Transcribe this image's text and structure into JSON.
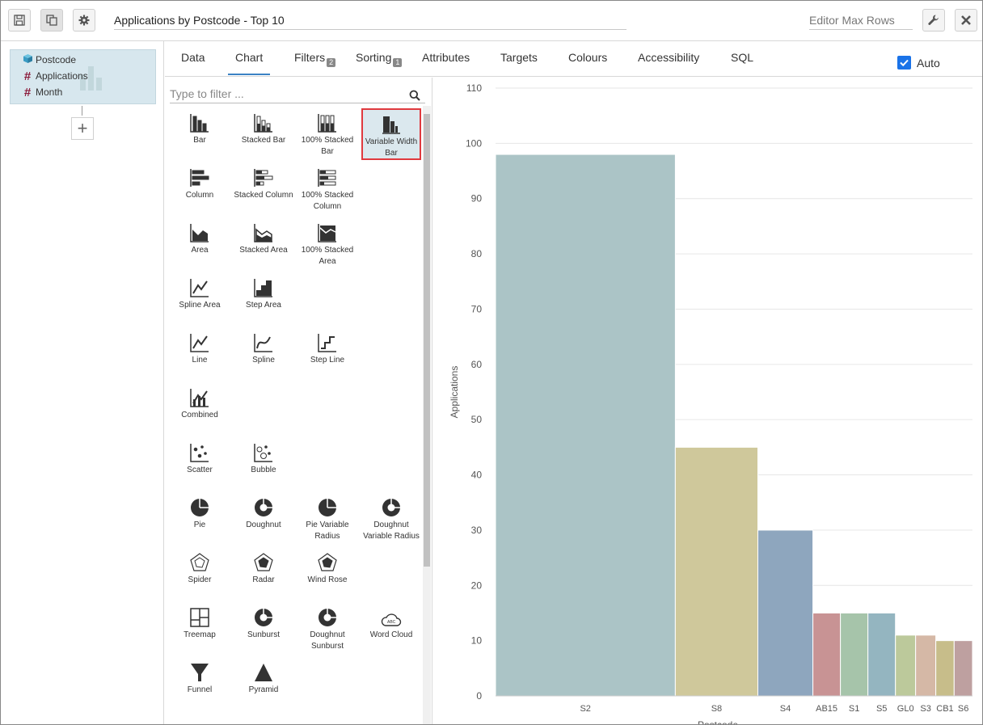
{
  "toolbar": {
    "title": "Applications by Postcode - Top 10",
    "max_rows_placeholder": "Editor Max Rows"
  },
  "fields": {
    "items": [
      {
        "label": "Postcode",
        "kind": "dimension"
      },
      {
        "label": "Applications",
        "kind": "measure"
      },
      {
        "label": "Month",
        "kind": "measure"
      }
    ],
    "add_label": "+"
  },
  "tabs": [
    {
      "label": "Data"
    },
    {
      "label": "Chart",
      "active": true
    },
    {
      "label": "Filters",
      "badge": "2"
    },
    {
      "label": "Sorting",
      "badge": "1"
    },
    {
      "label": "Attributes"
    },
    {
      "label": "Targets"
    },
    {
      "label": "Colours"
    },
    {
      "label": "Accessibility"
    },
    {
      "label": "SQL"
    }
  ],
  "auto": {
    "label": "Auto",
    "checked": true
  },
  "chart_types": {
    "filter_placeholder": "Type to filter ...",
    "items": [
      "Bar",
      "Stacked Bar",
      "100% Stacked Bar",
      "Variable Width Bar",
      "Column",
      "Stacked Column",
      "100% Stacked Column",
      "Area",
      "Stacked Area",
      "100% Stacked Area",
      "Spline Area",
      "Step Area",
      "Line",
      "Spline",
      "Step Line",
      "Combined",
      "Scatter",
      "Bubble",
      "Pie",
      "Doughnut",
      "Pie Variable Radius",
      "Doughnut Variable Radius",
      "Spider",
      "Radar",
      "Wind Rose",
      "Treemap",
      "Sunburst",
      "Doughnut Sunburst",
      "Word Cloud",
      "Funnel",
      "Pyramid"
    ],
    "selected": "Variable Width Bar"
  },
  "chart_data": {
    "type": "bar",
    "variable_width": true,
    "categories": [
      "S2",
      "S8",
      "S4",
      "AB15",
      "S1",
      "S5",
      "GL0",
      "S3",
      "CB1",
      "S6"
    ],
    "values": [
      98,
      45,
      30,
      15,
      15,
      15,
      11,
      11,
      10,
      10
    ],
    "colors": [
      "#abc4c6",
      "#cfc89b",
      "#8ea6be",
      "#c89394",
      "#a6c4aa",
      "#94b5c0",
      "#bcc99b",
      "#d5b8a6",
      "#c7bd8a",
      "#bea0a0"
    ],
    "ylabel": "Applications",
    "xlabel": "Postcode",
    "ylim": [
      0,
      110
    ],
    "yticks": [
      0,
      10,
      20,
      30,
      40,
      50,
      60,
      70,
      80,
      90,
      100,
      110
    ],
    "grid": true
  }
}
